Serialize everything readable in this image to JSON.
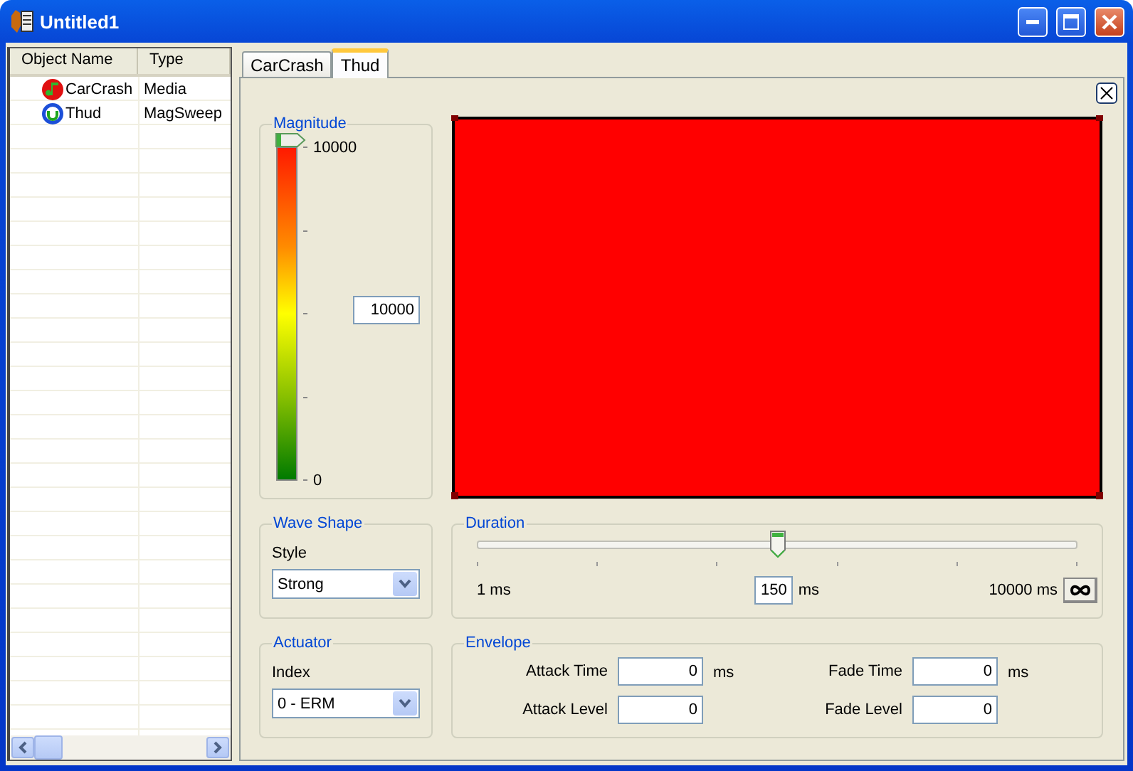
{
  "window": {
    "title": "Untitled1"
  },
  "object_list": {
    "columns": [
      "Object Name",
      "Type"
    ],
    "rows": [
      {
        "name": "CarCrash",
        "type": "Media",
        "kind": "media",
        "selected": false
      },
      {
        "name": "Thud",
        "type": "MagSweep",
        "kind": "magsweep",
        "selected": false
      }
    ]
  },
  "tabs": [
    {
      "label": "CarCrash",
      "selected": false
    },
    {
      "label": "Thud",
      "selected": true
    }
  ],
  "magnitude": {
    "title": "Magnitude",
    "max_label": "10000",
    "min_label": "0",
    "level": 1,
    "value": "10000"
  },
  "wave_shape": {
    "title": "Wave Shape",
    "label": "Style",
    "value": "Strong"
  },
  "duration": {
    "title": "Duration",
    "level": 0.5,
    "min_label": "1 ms",
    "value": "150",
    "unit": "ms",
    "max_label": "10000 ms"
  },
  "actuator": {
    "title": "Actuator",
    "label": "Index",
    "value": "0 - ERM"
  },
  "envelope": {
    "title": "Envelope",
    "fields": [
      {
        "label": "Attack Time",
        "value": "0",
        "unit": "ms"
      },
      {
        "label": "Fade Time",
        "value": "0",
        "unit": "ms"
      },
      {
        "label": "Attack Level",
        "value": "0"
      },
      {
        "label": "Fade Level",
        "value": "0"
      }
    ]
  }
}
